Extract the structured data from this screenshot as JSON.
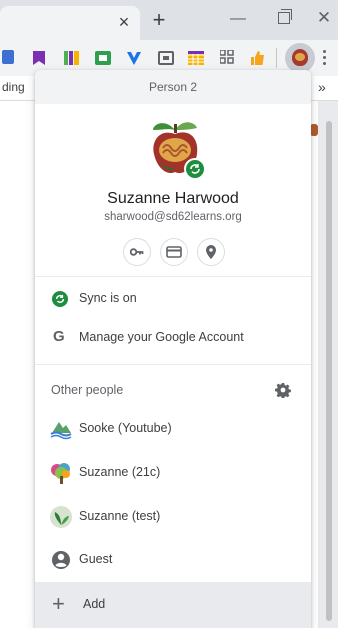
{
  "browser": {
    "tab_close_glyph": "×",
    "new_tab_glyph": "+",
    "minimize_glyph": "—",
    "close_glyph": "✕",
    "bookmark_fragment": "ding",
    "bookmark_more": "»"
  },
  "extensions": [
    {
      "icon": "notes-icon",
      "color": "#3b6fd1"
    },
    {
      "icon": "bookmark-ribbon-icon",
      "color": "#7b2fb5"
    },
    {
      "icon": "colorful-bars-icon",
      "color": "#4caf50"
    },
    {
      "icon": "image-frame-icon",
      "color": "#2e9e4f"
    },
    {
      "icon": "v-logo-icon",
      "color": "#1a73e8"
    },
    {
      "icon": "screen-capture-icon",
      "color": "#5f6368"
    },
    {
      "icon": "grid-table-icon",
      "color": "#f4b400"
    },
    {
      "icon": "apps-grid-icon",
      "color": "#5f6368"
    },
    {
      "icon": "thumbs-up-icon",
      "color": "#f4a51c"
    }
  ],
  "menu": {
    "header_title": "Person 2",
    "user_name": "Suzanne Harwood",
    "user_email": "sharwood@sd62learns.org",
    "quick_actions": [
      {
        "name": "passwords",
        "icon": "key-icon"
      },
      {
        "name": "payment-methods",
        "icon": "credit-card-icon"
      },
      {
        "name": "addresses",
        "icon": "location-pin-icon"
      }
    ],
    "sync_label": "Sync is on",
    "manage_label": "Manage your Google Account",
    "other_people_title": "Other people",
    "people": [
      {
        "label": "Sooke (Youtube)",
        "icon": "sooke-logo-icon"
      },
      {
        "label": "Suzanne (21c)",
        "icon": "tree-avatar-icon"
      },
      {
        "label": "Suzanne (test)",
        "icon": "plant-avatar-icon"
      },
      {
        "label": "Guest",
        "icon": "person-circle-icon"
      }
    ],
    "add_label": "Add"
  },
  "colors": {
    "sync_green": "#1e8e3e",
    "chrome_frame": "#dee1e6",
    "menu_header_bg": "#f1f3f4",
    "add_row_bg": "#e8eaed"
  }
}
